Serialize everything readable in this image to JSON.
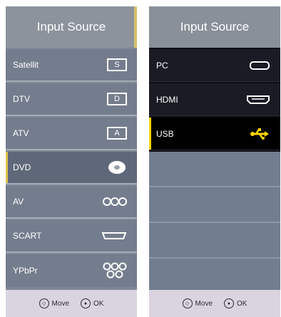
{
  "left_panel": {
    "title": "Input Source",
    "items": [
      {
        "label": "Satellit",
        "icon": "satellite-icon",
        "icon_text": "S"
      },
      {
        "label": "DTV",
        "icon": "dtv-icon",
        "icon_text": "D"
      },
      {
        "label": "ATV",
        "icon": "atv-icon",
        "icon_text": "A"
      },
      {
        "label": "DVD",
        "icon": "disc-icon"
      },
      {
        "label": "AV",
        "icon": "av-connectors-icon"
      },
      {
        "label": "SCART",
        "icon": "scart-icon"
      },
      {
        "label": "YPbPr",
        "icon": "component-connectors-icon"
      }
    ],
    "selected": "DVD",
    "footer": {
      "move_label": "Move",
      "ok_label": "OK"
    }
  },
  "right_panel": {
    "title": "Input Source",
    "items": [
      {
        "label": "PC",
        "icon": "vga-port-icon"
      },
      {
        "label": "HDMI",
        "icon": "hdmi-port-icon"
      },
      {
        "label": "USB",
        "icon": "usb-icon"
      }
    ],
    "selected": "USB",
    "footer": {
      "move_label": "Move",
      "ok_label": "OK"
    }
  },
  "colors": {
    "selection_accent": "#e0c24b",
    "usb_icon": "#ffd400"
  }
}
